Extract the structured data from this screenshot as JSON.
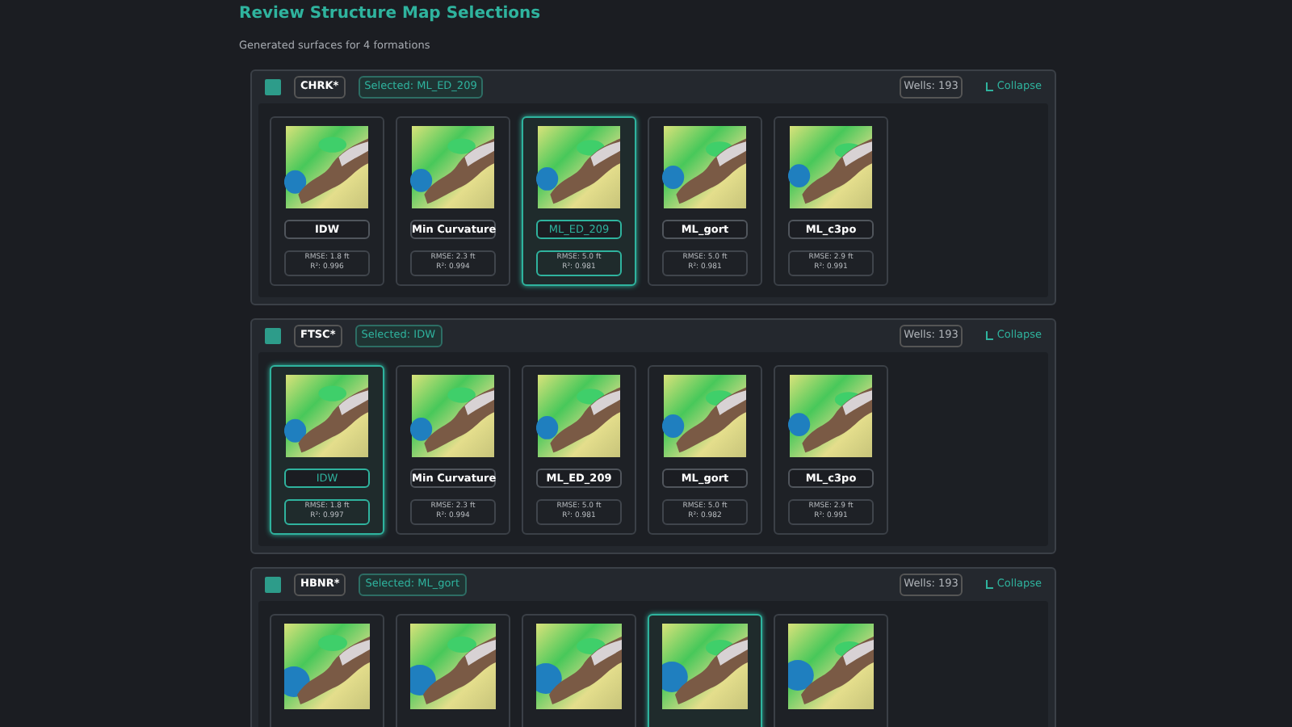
{
  "title": "Review Structure Map Selections",
  "subtitle": "Generated surfaces for 4 formations",
  "formations": [
    {
      "checked": true,
      "code": "CHRK*",
      "selected_label": "Selected: ML_ED_209",
      "wells": "Wells: 193",
      "collapse": "Collapse",
      "methods": [
        {
          "name": "IDW",
          "rmse": "RMSE: 1.8 ft",
          "r2": "R²: 0.996",
          "selected": false
        },
        {
          "name": "Min Curvature",
          "rmse": "RMSE: 2.3 ft",
          "r2": "R²: 0.994",
          "selected": false
        },
        {
          "name": "ML_ED_209",
          "rmse": "RMSE: 5.0 ft",
          "r2": "R²: 0.981",
          "selected": true
        },
        {
          "name": "ML_gort",
          "rmse": "RMSE: 5.0 ft",
          "r2": "R²: 0.981",
          "selected": false
        },
        {
          "name": "ML_c3po",
          "rmse": "RMSE: 2.9 ft",
          "r2": "R²: 0.991",
          "selected": false
        }
      ]
    },
    {
      "checked": true,
      "code": "FTSC*",
      "selected_label": "Selected: IDW",
      "wells": "Wells: 193",
      "collapse": "Collapse",
      "methods": [
        {
          "name": "IDW",
          "rmse": "RMSE: 1.8 ft",
          "r2": "R²: 0.997",
          "selected": true
        },
        {
          "name": "Min Curvature",
          "rmse": "RMSE: 2.3 ft",
          "r2": "R²: 0.994",
          "selected": false
        },
        {
          "name": "ML_ED_209",
          "rmse": "RMSE: 5.0 ft",
          "r2": "R²: 0.981",
          "selected": false
        },
        {
          "name": "ML_gort",
          "rmse": "RMSE: 5.0 ft",
          "r2": "R²: 0.982",
          "selected": false
        },
        {
          "name": "ML_c3po",
          "rmse": "RMSE: 2.9 ft",
          "r2": "R²: 0.991",
          "selected": false
        }
      ]
    },
    {
      "checked": true,
      "code": "HBNR*",
      "selected_label": "Selected: ML_gort",
      "wells": "Wells: 193",
      "collapse": "Collapse",
      "methods": [
        {
          "selected": false
        },
        {
          "selected": false
        },
        {
          "selected": false
        },
        {
          "selected": true
        },
        {
          "selected": false
        }
      ]
    }
  ]
}
